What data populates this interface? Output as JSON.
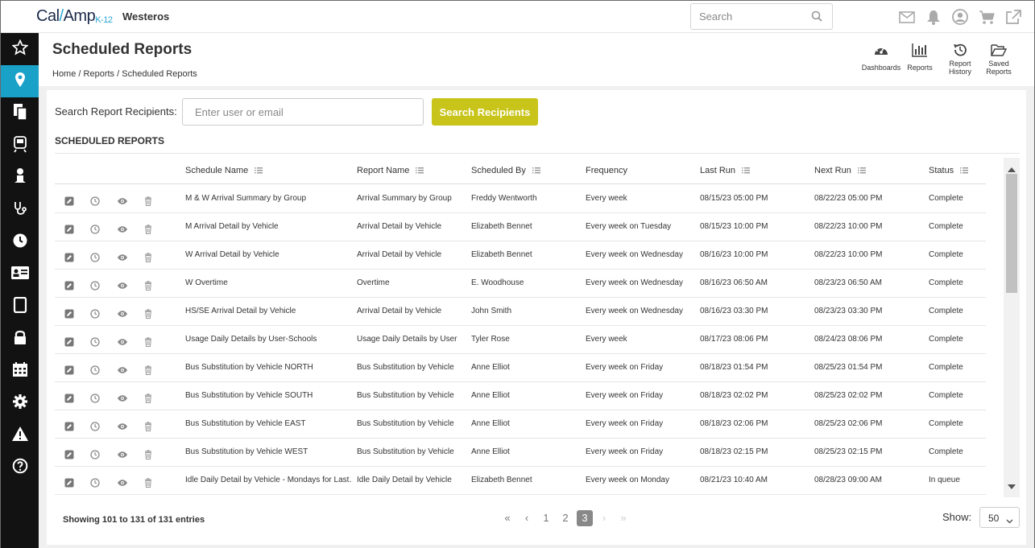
{
  "app": {
    "logo_a": "Cal",
    "logo_b": "Amp",
    "logo_k12": "K-12",
    "org": "Westeros"
  },
  "search": {
    "placeholder": "Search"
  },
  "topbar_icons": [
    "mail-icon",
    "bell-icon",
    "user-icon",
    "cart-icon",
    "external-link-icon"
  ],
  "sidebar": {
    "items": [
      {
        "icon": "star-icon",
        "active": false
      },
      {
        "icon": "map-pin-icon",
        "active": true
      },
      {
        "icon": "documents-icon",
        "active": false
      },
      {
        "icon": "bus-icon",
        "active": false
      },
      {
        "icon": "person-icon",
        "active": false
      },
      {
        "icon": "stethoscope-icon",
        "active": false
      },
      {
        "icon": "clock-icon",
        "active": false
      },
      {
        "icon": "id-card-icon",
        "active": false
      },
      {
        "icon": "tablet-icon",
        "active": false
      },
      {
        "icon": "lock-icon",
        "active": false
      },
      {
        "icon": "calendar-icon",
        "active": false
      },
      {
        "icon": "gear-icon",
        "active": false
      },
      {
        "icon": "warning-icon",
        "active": false
      },
      {
        "icon": "help-icon",
        "active": false
      }
    ],
    "active_color": "#1aa1c8"
  },
  "page": {
    "title": "Scheduled Reports",
    "breadcrumb": {
      "home": "Home",
      "sep1": "/",
      "reports": "Reports",
      "sep2": "/",
      "current": "Scheduled Reports"
    }
  },
  "quicknav": [
    {
      "icon": "dashboard-icon",
      "line1": "Dashboards",
      "line2": ""
    },
    {
      "icon": "bar-chart-icon",
      "line1": "Reports",
      "line2": ""
    },
    {
      "icon": "history-icon",
      "line1": "Report",
      "line2": "History"
    },
    {
      "icon": "folder-open-icon",
      "line1": "Saved",
      "line2": "Reports"
    }
  ],
  "recipients": {
    "label": "Search Report Recipients:",
    "placeholder": "Enter user or email",
    "button": "Search Recipients",
    "button_color": "#c8c41a"
  },
  "section_title": "SCHEDULED REPORTS",
  "table": {
    "headers": [
      "Schedule Name",
      "Report Name",
      "Scheduled By",
      "Frequency",
      "Last Run",
      "Next Run",
      "Status"
    ],
    "rows": [
      [
        "M & W Arrival Summary by Group",
        "Arrival Summary by Group",
        "Freddy Wentworth",
        "Every week",
        "08/15/23 05:00 PM",
        "08/22/23 05:00 PM",
        "Complete"
      ],
      [
        "M Arrival Detail by Vehicle",
        "Arrival Detail by Vehicle",
        "Elizabeth Bennet",
        "Every week on Tuesday",
        "08/15/23 10:00 PM",
        "08/22/23 10:00 PM",
        "Complete"
      ],
      [
        "W Arrival Detail by Vehicle",
        "Arrival Detail by Vehicle",
        "Elizabeth Bennet",
        "Every week on Wednesday",
        "08/16/23 10:00 PM",
        "08/22/23 10:00 PM",
        "Complete"
      ],
      [
        "W Overtime",
        "Overtime",
        "E. Woodhouse",
        "Every week on Wednesday",
        "08/16/23 06:50 AM",
        "08/23/23 06:50 AM",
        "Complete"
      ],
      [
        "HS/SE Arrival Detail by Vehicle",
        "Arrival Detail by Vehicle",
        "John Smith",
        "Every week on Wednesday",
        "08/16/23 03:30 PM",
        "08/23/23 03:30 PM",
        "Complete"
      ],
      [
        "Usage Daily Details by User-Schools",
        "Usage Daily Details by User",
        "Tyler Rose",
        "Every week",
        "08/17/23 08:06 PM",
        "08/24/23 08:06 PM",
        "Complete"
      ],
      [
        "Bus Substitution by Vehicle NORTH",
        "Bus Substitution by Vehicle",
        "Anne Elliot",
        "Every week on Friday",
        "08/18/23 01:54 PM",
        "08/25/23 01:54 PM",
        "Complete"
      ],
      [
        "Bus Substitution by Vehicle SOUTH",
        "Bus Substitution by Vehicle",
        "Anne Elliot",
        "Every week on Friday",
        "08/18/23 02:02 PM",
        "08/25/23 02:02 PM",
        "Complete"
      ],
      [
        "Bus Substitution by Vehicle EAST",
        "Bus Substitution by Vehicle",
        "Anne Elliot",
        "Every week on Friday",
        "08/18/23 02:06 PM",
        "08/25/23 02:06 PM",
        "Complete"
      ],
      [
        "Bus Substitution by Vehicle WEST",
        "Bus Substitution by Vehicle",
        "Anne Elliot",
        "Every week on Friday",
        "08/18/23 02:15 PM",
        "08/25/23 02:15 PM",
        "Complete"
      ],
      [
        "Idle Daily Detail by Vehicle - Mondays for Last…",
        "Idle Daily Detail by Vehicle",
        "Elizabeth Bennet",
        "Every week on Monday",
        "08/21/23 10:40 AM",
        "08/28/23 09:00 AM",
        "In queue"
      ]
    ],
    "row_actions": [
      "edit-icon",
      "clock-icon",
      "eye-icon",
      "trash-icon"
    ]
  },
  "footer": {
    "showing": "Showing 101 to 131 of 131 entries",
    "pages": [
      "1",
      "2",
      "3"
    ],
    "current_page": "3",
    "show_label": "Show:",
    "page_size": "50"
  }
}
